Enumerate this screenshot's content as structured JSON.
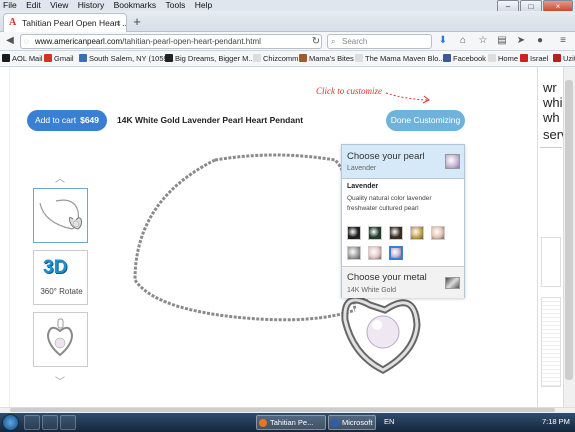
{
  "menubar": {
    "items": [
      "File",
      "Edit",
      "View",
      "History",
      "Bookmarks",
      "Tools",
      "Help"
    ]
  },
  "tab": {
    "title": "Tahitian Pearl Open Heart ...",
    "close": "×",
    "new_tab": "+"
  },
  "window": {
    "minimize": "–",
    "maximize": "□",
    "close": "×"
  },
  "nav": {
    "url_host": "www.americanpearl.com",
    "url_path": "/tahitian-pearl-open-heart-pendant.html",
    "search_placeholder": "Search"
  },
  "bookmarks": [
    {
      "label": "AOL Mail",
      "color": "#1b1b1b"
    },
    {
      "label": "Gmail",
      "color": "#d93025"
    },
    {
      "label": "South Salem, NY (1059...",
      "color": "#3a6fb0"
    },
    {
      "label": "Big Dreams, Bigger M...",
      "color": "#222222"
    },
    {
      "label": "Chizcomm",
      "color": "#dddddd"
    },
    {
      "label": "Mama's Bites",
      "color": "#a05a2c"
    },
    {
      "label": "The Mama Maven Blo...",
      "color": "#dddddd"
    },
    {
      "label": "Facebook",
      "color": "#3b5998"
    },
    {
      "label": "Home",
      "color": "#dddddd"
    },
    {
      "label": "Israel",
      "color": "#cc2222"
    },
    {
      "label": "Uzit",
      "color": "#b22222"
    }
  ],
  "product": {
    "add_to_cart_label": "Add to cart",
    "price": "$649",
    "title": "14K White Gold Lavender Pearl Heart Pendant",
    "click_hint": "Click to customize",
    "done_label": "Done Customizing"
  },
  "thumbnails": {
    "rotate_3d": "3D",
    "rotate_label": "360° Rotate"
  },
  "customizer": {
    "pearl_heading": "Choose your pearl",
    "pearl_selected": "Lavender",
    "pearl_detail_name": "Lavender",
    "pearl_detail_desc": "Quality natural color lavender freshwater cultured pearl",
    "pearl_swatches": [
      {
        "color": "#1a1a1a",
        "selected": false
      },
      {
        "color": "#1f3a2a",
        "selected": false
      },
      {
        "color": "#3a2a1e",
        "selected": false
      },
      {
        "color": "#c6a24a",
        "selected": false
      },
      {
        "color": "#e2c4b0",
        "selected": false
      },
      {
        "color": "#9e9e9e",
        "selected": false
      },
      {
        "color": "#e6c8c8",
        "selected": false
      },
      {
        "color": "#c9b6d8",
        "selected": true
      }
    ],
    "metal_heading": "Choose your metal",
    "metal_selected": "14K White Gold"
  },
  "right_column": {
    "lines": [
      "wr",
      "whi",
      "wh",
      "abo",
      "serv"
    ]
  },
  "taskbar": {
    "buttons": [
      "Tahitian Pe...",
      "Microsoft ..."
    ],
    "language": "EN",
    "time": "7:18 PM"
  }
}
